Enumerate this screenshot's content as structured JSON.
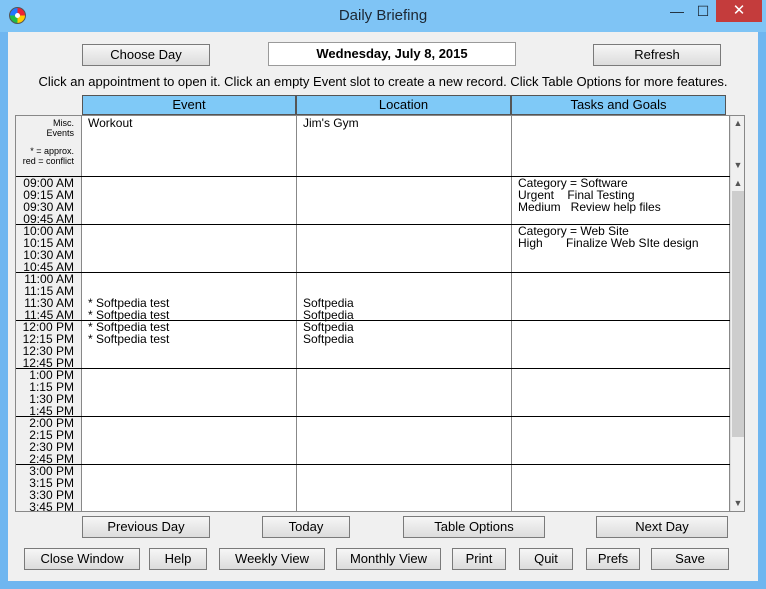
{
  "window": {
    "title": "Daily Briefing",
    "min_glyph": "—",
    "max_glyph": "☐",
    "close_glyph": "✕"
  },
  "top": {
    "choose_day": "Choose Day",
    "date": "Wednesday, July 8, 2015",
    "refresh": "Refresh",
    "instructions": "Click an appointment to open it. Click an empty Event slot to create a new record. Click Table Options for more features."
  },
  "columns": {
    "event": "Event",
    "location": "Location",
    "tasks": "Tasks and Goals"
  },
  "misc": {
    "line1": "Misc.",
    "line2": "Events",
    "line3": "* = approx.",
    "line4": "red = conflict"
  },
  "misc_row": {
    "event": "Workout",
    "location": "Jim's Gym"
  },
  "times": [
    "09:00 AM",
    "09:15 AM",
    "09:30 AM",
    "09:45 AM",
    "10:00 AM",
    "10:15 AM",
    "10:30 AM",
    "10:45 AM",
    "11:00 AM",
    "11:15 AM",
    "11:30 AM",
    "11:45 AM",
    "12:00 PM",
    "12:15 PM",
    "12:30 PM",
    "12:45 PM",
    "1:00 PM",
    "1:15 PM",
    "1:30 PM",
    "1:45 PM",
    "2:00 PM",
    "2:15 PM",
    "2:30 PM",
    "2:45 PM",
    "3:00 PM",
    "3:15 PM",
    "3:30 PM",
    "3:45 PM"
  ],
  "events": [
    {
      "event": "* Softpedia test",
      "location": "Softpedia"
    },
    {
      "event": "* Softpedia test",
      "location": "Softpedia"
    },
    {
      "event": "* Softpedia test",
      "location": "Softpedia"
    },
    {
      "event": "* Softpedia test",
      "location": "Softpedia"
    }
  ],
  "tasks": {
    "block1": [
      "Category = Software",
      "Urgent    Final Testing",
      "Medium   Review help files"
    ],
    "block2": [
      "Category = Web Site",
      "High       Finalize Web SIte design"
    ]
  },
  "scroll": {
    "up": "▲",
    "down": "▼"
  },
  "nav": {
    "previous": "Previous Day",
    "today": "Today",
    "table_options": "Table Options",
    "next": "Next Day"
  },
  "bottom": {
    "close": "Close Window",
    "help": "Help",
    "weekly": "Weekly View",
    "monthly": "Monthly View",
    "print": "Print",
    "quit": "Quit",
    "prefs": "Prefs",
    "save": "Save"
  }
}
